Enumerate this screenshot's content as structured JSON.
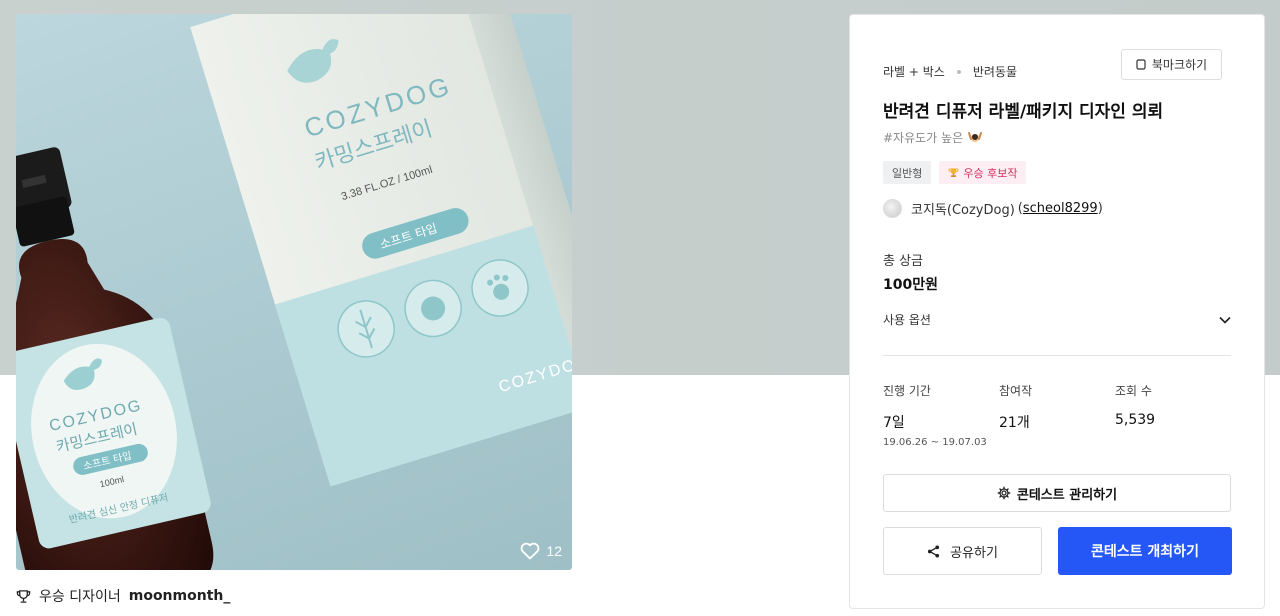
{
  "hero": {
    "likes": "12",
    "box_brand": "COZYDOG",
    "box_product": "카밍스프레이",
    "box_volume": "3.38 FL.OZ / 100ml",
    "box_type": "소프트 타입",
    "bottle_brand": "COZYDOG",
    "bottle_product": "카밍스프레이",
    "bottle_type": "소프트 타입",
    "bottle_volume": "100ml",
    "bottle_desc": "반려견 심신 안정 디퓨저"
  },
  "winner": {
    "prefix": "우승 디자이너",
    "name": "moonmonth_"
  },
  "contest": {
    "category": "라벨 + 박스",
    "subcategory": "반려동물",
    "bookmark_label": "북마크하기",
    "title": "반려견 디퓨저 라벨/패키지 디자인 의뢰",
    "tag": "#자유도가 높은",
    "badge_type": "일반형",
    "badge_award": "우승 후보작",
    "owner_name": "코지독(CozyDog)",
    "owner_id": "scheol8299",
    "prize_label": "총 상금",
    "prize_value": "100만원",
    "usage_label": "사용 옵션",
    "stats": [
      {
        "label": "진행 기간",
        "value": "7일",
        "sub": "19.06.26 ~ 19.07.03"
      },
      {
        "label": "참여작",
        "value": "21개",
        "sub": ""
      },
      {
        "label": "조회 수",
        "value": "5,539",
        "sub": ""
      }
    ],
    "manage_label": "콘테스트 관리하기",
    "share_label": "공유하기",
    "host_label": "콘테스트 개최하기"
  },
  "colors": {
    "primary": "#2457f5",
    "mint": "#bfe0e2",
    "award": "#d1305e"
  }
}
